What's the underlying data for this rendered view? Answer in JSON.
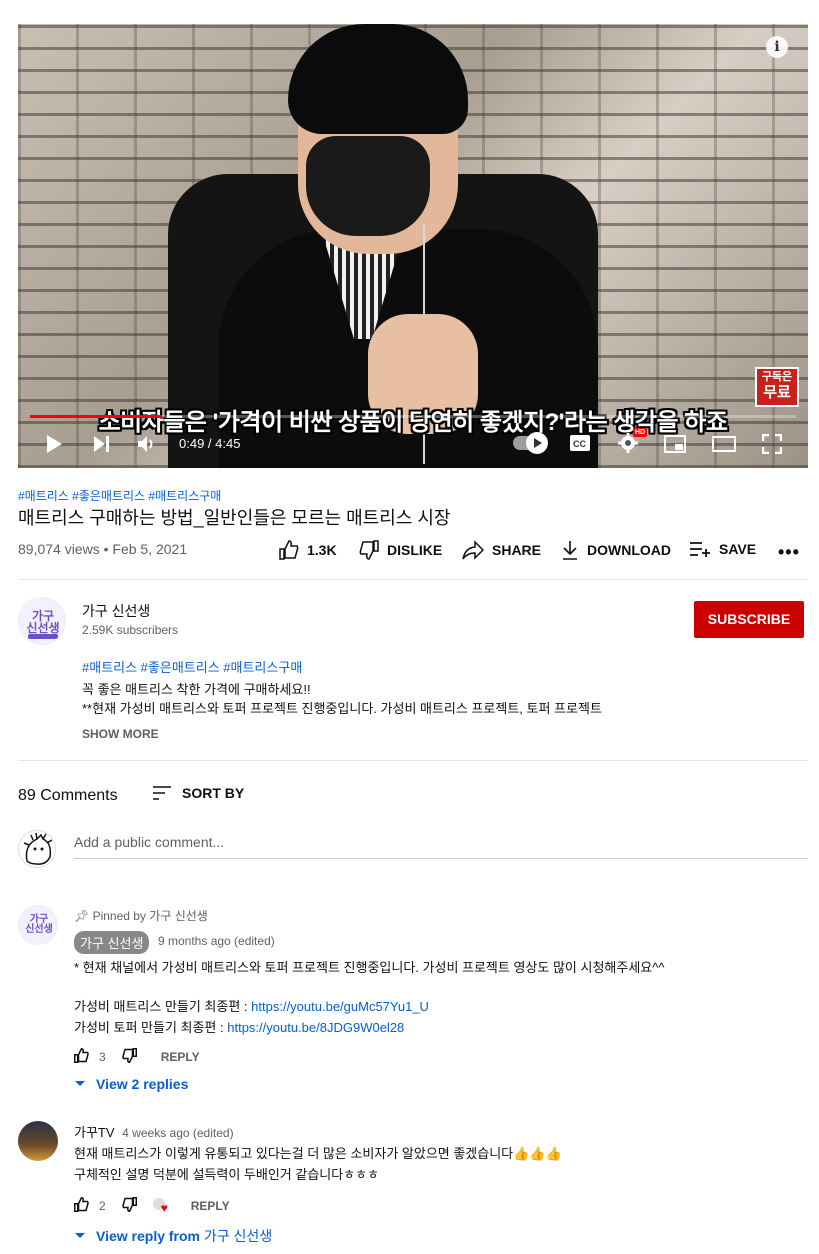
{
  "player": {
    "caption": "소비자들은 '가격이 비싼 상품이 당연히 좋겠지?'라는 생각을 하죠",
    "badge_top": "구독은",
    "badge_bottom": "무료",
    "time": "0:49 / 4:45",
    "progress": 0.172,
    "hd_label": "HD"
  },
  "video": {
    "hashtags": "#매트리스 #좋은매트리스 #매트리스구매",
    "title": "매트리스 구매하는 방법_일반인들은 모르는 매트리스 시장",
    "views": "89,074 views • Feb 5, 2021",
    "like_count": "1.3K",
    "dislike_label": "DISLIKE",
    "share_label": "SHARE",
    "download_label": "DOWNLOAD",
    "save_label": "SAVE",
    "more": "•••"
  },
  "channel": {
    "name": "가구 신선생",
    "subscribers": "2.59K subscribers",
    "subscribe_label": "SUBSCRIBE",
    "avatar_text": "가구\n신선생"
  },
  "description": {
    "tags": "#매트리스 #좋은매트리스 #매트리스구매",
    "line1": "꼭 좋은 매트리스 착한 가격에 구매하세요!!",
    "line2": "**현재 가성비 매트리스와 토퍼 프로젝트 진행중입니다. 가성비 매트리스 프로젝트, 토퍼 프로젝트",
    "show_more": "SHOW MORE"
  },
  "comments": {
    "count_label": "89 Comments",
    "sort_label": "SORT BY",
    "add_placeholder": "Add a public comment...",
    "items": [
      {
        "pinned": "Pinned by 가구 신선생",
        "author": "가구 신선생",
        "meta": "9 months ago (edited)",
        "text1": "* 현재 채널에서 가성비 매트리스와 토퍼 프로젝트 진행중입니다. 가성비 프로젝트 영상도 많이 시청해주세요^^",
        "text2_prefix": "가성비 매트리스 만들기 최종편 : ",
        "text2_link": "https://youtu.be/guMc57Yu1_U",
        "text3_prefix": "가성비 토퍼 만들기 최종편 : ",
        "text3_link": "https://youtu.be/8JDG9W0el28",
        "likes": "3",
        "reply_label": "REPLY",
        "replies_label": "View 2 replies"
      },
      {
        "author": "가꾸TV",
        "meta": "4 weeks ago (edited)",
        "text1": "현재 매트리스가 이렇게 유통되고 있다는걸  더 많은 소비자가 알았으면 좋겠습니다",
        "emoji": "👍👍👍",
        "text2": "구체적인 설명 덕분에 설득력이 두배인거 같습니다ㅎㅎㅎ",
        "likes": "2",
        "reply_label": "REPLY",
        "replies_label": "View reply from",
        "replies_author": "가구 신선생"
      }
    ]
  }
}
